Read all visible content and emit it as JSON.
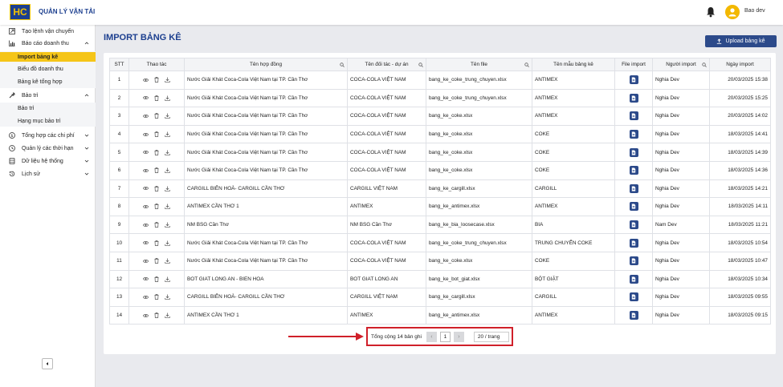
{
  "header": {
    "logo_text": "HC",
    "app_title": "QUẢN LÝ VẬN TẢI",
    "user_name": "Bao dev"
  },
  "sidebar": {
    "items": [
      {
        "label": "Tạo lệnh vận chuyển",
        "icon": "arrow-box-icon"
      },
      {
        "label": "Báo cáo doanh thu",
        "icon": "chart-icon",
        "expanded": true,
        "children": [
          "Import bảng kê",
          "Biểu đồ doanh thu",
          "Bảng kê tổng hợp"
        ]
      },
      {
        "label": "Bảo trì",
        "icon": "wrench-icon",
        "expanded": true,
        "children": [
          "Bảo trì",
          "Hạng mục bảo trì"
        ]
      },
      {
        "label": "Tổng hợp các chi phí",
        "icon": "dollar-icon"
      },
      {
        "label": "Quản lý các thời hạn",
        "icon": "clock-icon"
      },
      {
        "label": "Dữ liệu hệ thống",
        "icon": "database-icon"
      },
      {
        "label": "Lịch sử",
        "icon": "history-icon"
      }
    ],
    "active_child": "Import bảng kê"
  },
  "page": {
    "title": "IMPORT BẢNG KÊ",
    "upload_label": "Upload bảng kê"
  },
  "table": {
    "columns": [
      "STT",
      "Thao tác",
      "Tên hợp đồng",
      "Tên đối tác - dự án",
      "Tên file",
      "Tên mẫu bảng kê",
      "File import",
      "Người import",
      "Ngày import"
    ],
    "rows": [
      {
        "stt": "1",
        "contract": "Nước Giải Khát Coca-Cola Việt Nam tại TP. Cần Thơ",
        "partner": "COCA-COLA VIỆT NAM",
        "file": "bang_ke_coke_trung_chuyen.xlsx",
        "template": "ANTIMEX",
        "user": "Nghia Dev",
        "date": "20/03/2025 15:38"
      },
      {
        "stt": "2",
        "contract": "Nước Giải Khát Coca-Cola Việt Nam tại TP. Cần Thơ",
        "partner": "COCA-COLA VIỆT NAM",
        "file": "bang_ke_coke_trung_chuyen.xlsx",
        "template": "ANTIMEX",
        "user": "Nghia Dev",
        "date": "20/03/2025 15:25"
      },
      {
        "stt": "3",
        "contract": "Nước Giải Khát Coca-Cola Việt Nam tại TP. Cần Thơ",
        "partner": "COCA-COLA VIỆT NAM",
        "file": "bang_ke_coke.xlsx",
        "template": "ANTIMEX",
        "user": "Nghia Dev",
        "date": "20/03/2025 14:02"
      },
      {
        "stt": "4",
        "contract": "Nước Giải Khát Coca-Cola Việt Nam tại TP. Cần Thơ",
        "partner": "COCA-COLA VIỆT NAM",
        "file": "bang_ke_coke.xlsx",
        "template": "COKE",
        "user": "Nghia Dev",
        "date": "18/03/2025 14:41"
      },
      {
        "stt": "5",
        "contract": "Nước Giải Khát Coca-Cola Việt Nam tại TP. Cần Thơ",
        "partner": "COCA-COLA VIỆT NAM",
        "file": "bang_ke_coke.xlsx",
        "template": "COKE",
        "user": "Nghia Dev",
        "date": "18/03/2025 14:39"
      },
      {
        "stt": "6",
        "contract": "Nước Giải Khát Coca-Cola Việt Nam tại TP. Cần Thơ",
        "partner": "COCA-COLA VIỆT NAM",
        "file": "bang_ke_coke.xlsx",
        "template": "COKE",
        "user": "Nghia Dev",
        "date": "18/03/2025 14:36"
      },
      {
        "stt": "7",
        "contract": "CARGILL BIÊN HOÀ- CARGILL CẦN THƠ",
        "partner": "CARGILL VIỆT NAM",
        "file": "bang_ke_cargill.xlsx",
        "template": "CARGILL",
        "user": "Nghia Dev",
        "date": "18/03/2025 14:21"
      },
      {
        "stt": "8",
        "contract": "ANTIMEX CẦN THƠ 1",
        "partner": "ANTIMEX",
        "file": "bang_ke_antimex.xlsx",
        "template": "ANTIMEX",
        "user": "Nghia Dev",
        "date": "18/03/2025 14:11"
      },
      {
        "stt": "9",
        "contract": "NM BSG Cần Thơ",
        "partner": "NM BSG Cần Thơ",
        "file": "bang_ke_bia_loosecase.xlsx",
        "template": "BIA",
        "user": "Nam Dev",
        "date": "18/03/2025 11:21"
      },
      {
        "stt": "10",
        "contract": "Nước Giải Khát Coca-Cola Việt Nam tại TP. Cần Thơ",
        "partner": "COCA-COLA VIỆT NAM",
        "file": "bang_ke_coke_trung_chuyen.xlsx",
        "template": "TRUNG CHUYỂN COKE",
        "user": "Nghia Dev",
        "date": "18/03/2025 10:54"
      },
      {
        "stt": "11",
        "contract": "Nước Giải Khát Coca-Cola Việt Nam tại TP. Cần Thơ",
        "partner": "COCA-COLA VIỆT NAM",
        "file": "bang_ke_coke.xlsx",
        "template": "COKE",
        "user": "Nghia Dev",
        "date": "18/03/2025 10:47"
      },
      {
        "stt": "12",
        "contract": "BOT GIAT LONG AN - BIEN HOA",
        "partner": "BOT GIAT LONG AN",
        "file": "bang_ke_bot_giat.xlsx",
        "template": "BỘT GIẶT",
        "user": "Nghia Dev",
        "date": "18/03/2025 10:34"
      },
      {
        "stt": "13",
        "contract": "CARGILL BIÊN HOÀ- CARGILL CẦN THƠ",
        "partner": "CARGILL VIỆT NAM",
        "file": "bang_ke_cargill.xlsx",
        "template": "CARGILL",
        "user": "Nghia Dev",
        "date": "18/03/2025 09:55"
      },
      {
        "stt": "14",
        "contract": "ANTIMEX CẦN THƠ 1",
        "partner": "ANTIMEX",
        "file": "bang_ke_antimex.xlsx",
        "template": "ANTIMEX",
        "user": "Nghia Dev",
        "date": "18/03/2025 09:15"
      }
    ]
  },
  "pagination": {
    "total_text": "Tổng cộng 14 bản ghi",
    "prev": "‹",
    "current": "1",
    "next": "›",
    "page_size": "20 / trang"
  },
  "colors": {
    "accent": "#1c3f8f",
    "active_nav": "#f5c518",
    "highlight": "#d0202a"
  }
}
